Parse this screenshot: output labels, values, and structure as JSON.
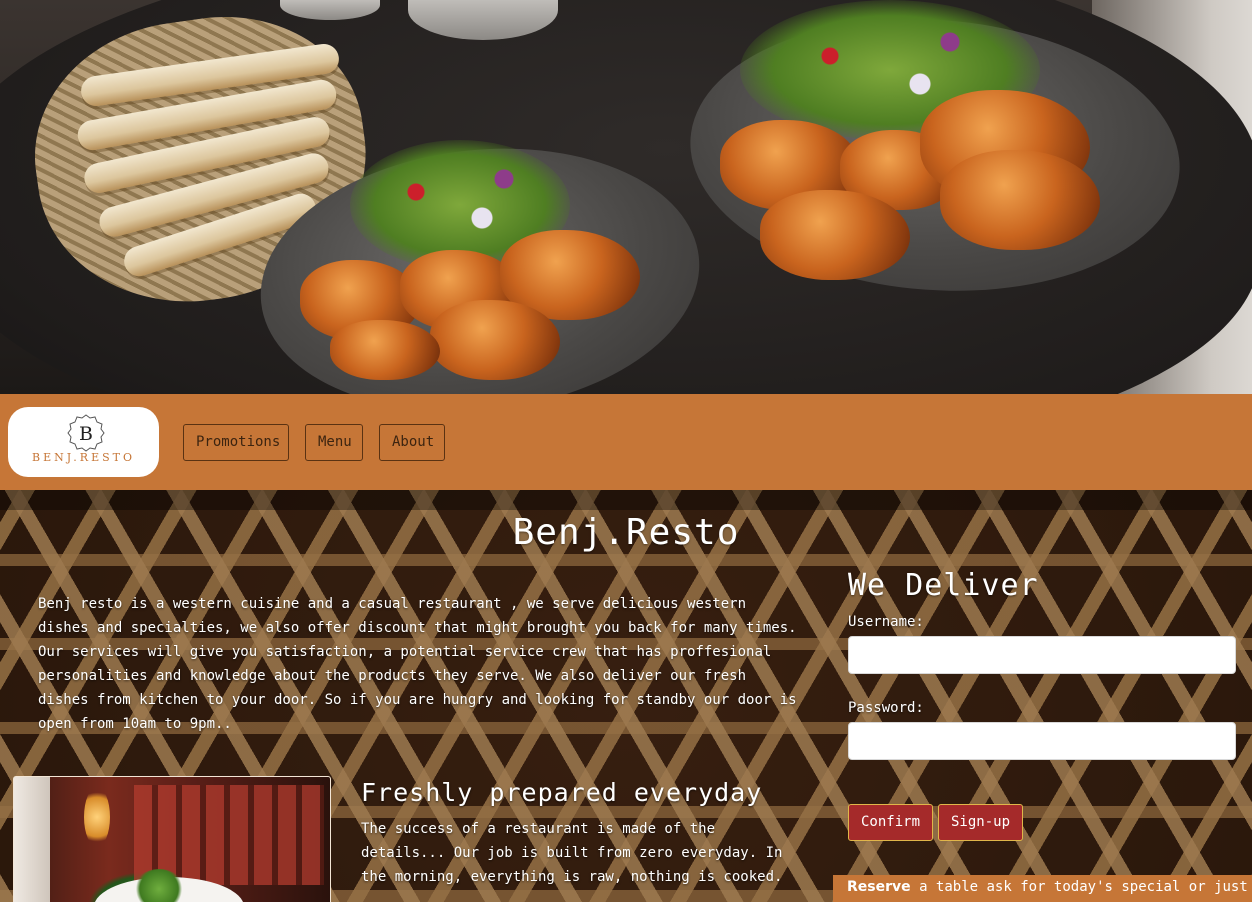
{
  "brand": {
    "logo_monogram": "B",
    "logo_wordmark": "BENJ.RESTO"
  },
  "nav": {
    "items": [
      {
        "label": "Promotions"
      },
      {
        "label": "Menu"
      },
      {
        "label": "About"
      }
    ]
  },
  "main": {
    "title": "Benj.Resto",
    "intro": "Benj resto is a western cuisine and a casual restaurant , we serve delicious western dishes and specialties, we also offer discount that might brought you back for many times. Our services will give you satisfaction, a potential service crew that has proffesional personalities and knowledge about the products they serve. We also deliver our fresh dishes from kitchen to your door. So if you are hungry and looking for standby our door is open from 10am to 9pm..",
    "fresh_title": "Freshly prepared everyday",
    "fresh_text": "The success of a restaurant is made of the details... Our job is built from zero everyday. In the morning, everything is raw, nothing is cooked."
  },
  "delivery": {
    "title": "We Deliver",
    "username_label": "Username:",
    "username_value": "",
    "password_label": "Password:",
    "password_value": "",
    "confirm_label": "Confirm",
    "signup_label": "Sign-up"
  },
  "reserve": {
    "strong": "Reserve",
    "text": " a table ask for today's special or just"
  },
  "colors": {
    "nav_bg": "#c67637",
    "button_red": "#a52a2a",
    "button_border": "#e0b64a"
  }
}
